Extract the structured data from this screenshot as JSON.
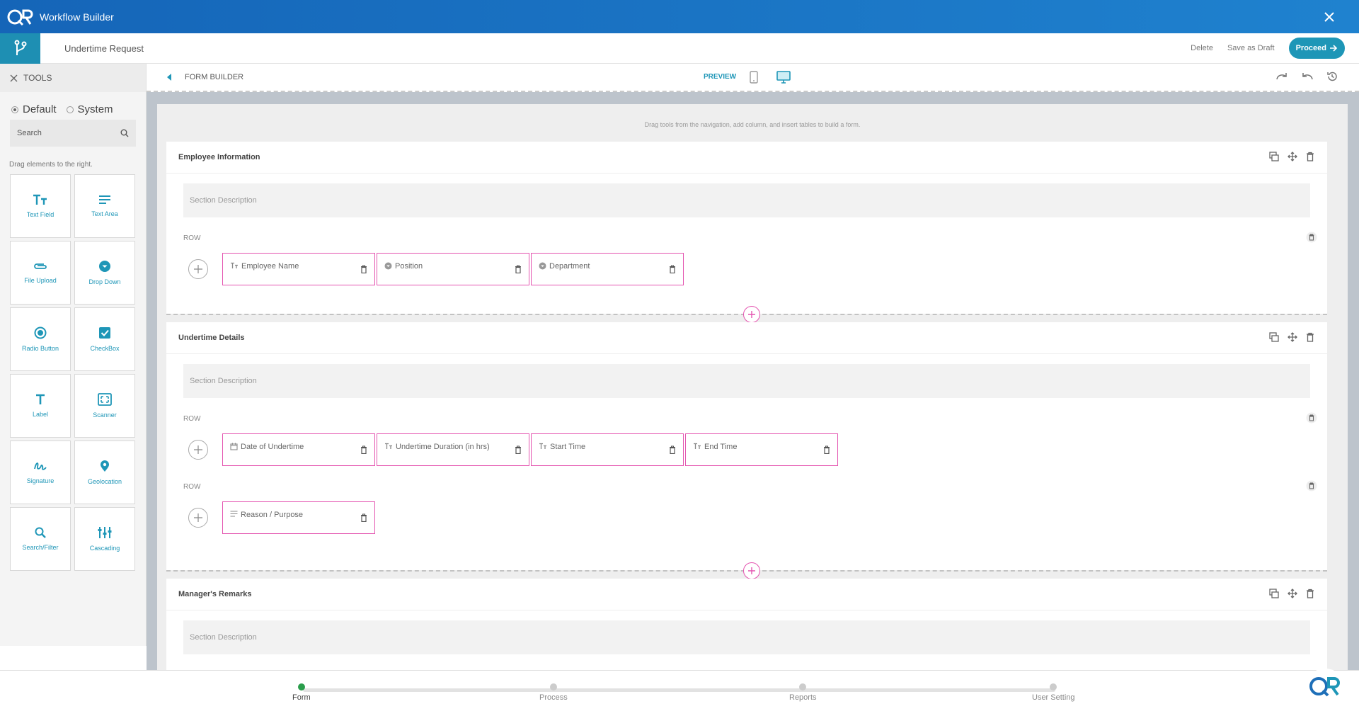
{
  "window": {
    "title": "Workflow Builder",
    "brand_color": "#1f82cf",
    "accent": "#1e96b7"
  },
  "header": {
    "form_name": "Undertime Request",
    "delete_label": "Delete",
    "draft_label": "Save as Draft",
    "proceed_label": "Proceed"
  },
  "sidebar": {
    "title": "TOOLS",
    "radio_default": "Default",
    "radio_system": "System",
    "search_placeholder": "Search",
    "drag_hint": "Drag elements to the right.",
    "tools": [
      {
        "label": "Text Field",
        "icon": "text-field-icon"
      },
      {
        "label": "Text Area",
        "icon": "text-area-icon"
      },
      {
        "label": "File Upload",
        "icon": "paperclip-icon"
      },
      {
        "label": "Drop Down",
        "icon": "dropdown-icon"
      },
      {
        "label": "Radio Button",
        "icon": "radio-icon"
      },
      {
        "label": "CheckBox",
        "icon": "checkbox-icon"
      },
      {
        "label": "Label",
        "icon": "label-icon"
      },
      {
        "label": "Scanner",
        "icon": "scanner-icon"
      },
      {
        "label": "Signature",
        "icon": "signature-icon"
      },
      {
        "label": "Geolocation",
        "icon": "location-pin-icon"
      },
      {
        "label": "Search/Filter",
        "icon": "search-icon"
      },
      {
        "label": "Cascading",
        "icon": "cascading-icon"
      }
    ]
  },
  "toolbar": {
    "title": "FORM BUILDER",
    "preview_label": "PREVIEW"
  },
  "canvas": {
    "hint": "Drag tools from the navigation, add column, and insert tables to build a form.",
    "row_label": "ROW",
    "section_desc_placeholder": "Section Description",
    "sections": [
      {
        "title": "Employee Information",
        "rows": [
          [
            "Employee Name",
            "Position",
            "Department"
          ]
        ]
      },
      {
        "title": "Undertime Details",
        "rows": [
          [
            "Date of Undertime",
            "Undertime Duration (in hrs)",
            "Start Time",
            "End Time"
          ],
          [
            "Reason / Purpose"
          ]
        ]
      },
      {
        "title": "Manager's Remarks",
        "rows": []
      }
    ]
  },
  "stepper": {
    "steps": [
      "Form",
      "Process",
      "Reports",
      "User Setting"
    ],
    "active": "Form"
  }
}
